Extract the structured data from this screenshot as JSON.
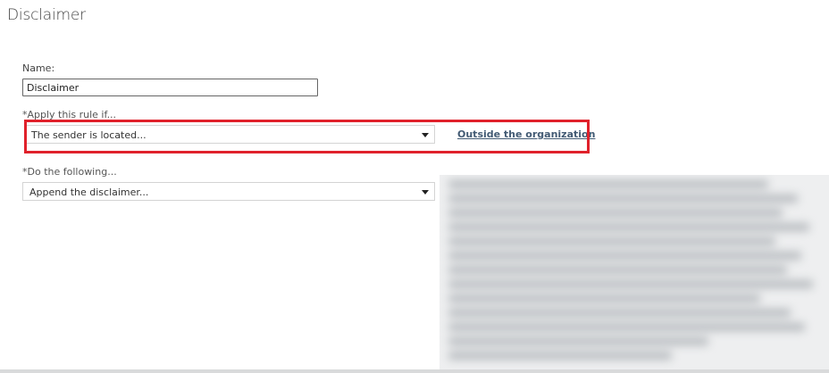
{
  "page": {
    "title": "Disclaimer"
  },
  "form": {
    "name_label": "Name:",
    "name_value": "Disclaimer",
    "apply_label": "*Apply this rule if...",
    "condition_value": "The sender is located...",
    "condition_link": "Outside the organization",
    "do_label": "*Do the following...",
    "action_value": "Append the disclaimer..."
  },
  "colors": {
    "highlight": "#e0212b",
    "link": "#435b74"
  }
}
